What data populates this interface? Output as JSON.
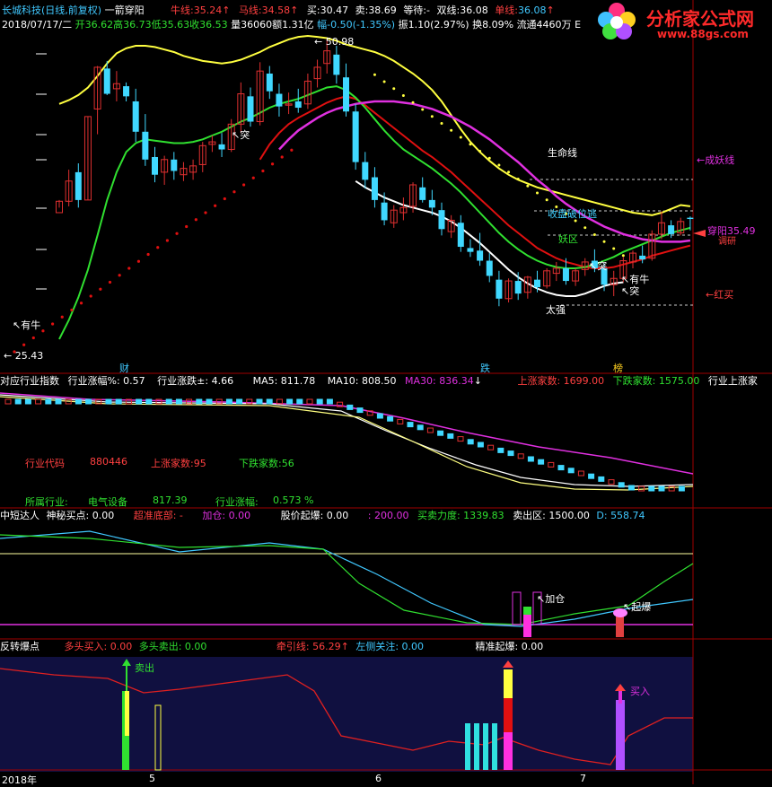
{
  "header": {
    "stock": "长城科技",
    "mode": "(日线,前复权)",
    "formula": "一箭穿阳",
    "niu_label": "牛线:",
    "niu_val": "35.24",
    "ma_label": "马线:",
    "ma_val": "34.58",
    "buy_label": "买:",
    "buy_val": "30.47",
    "sell_label": "卖:",
    "sell_val": "38.69",
    "wait_label": "等待:",
    "wait_val": "-",
    "double_label": "双线:",
    "double_val": "36.08",
    "single_label": "单线:",
    "single_val": "36.08",
    "date": "2018/07/17/二",
    "open": "开36.62",
    "high": "高36.73",
    "low": "低35.63",
    "close": "收36.53",
    "vol": "量36060",
    "amt": "额1.31亿",
    "fu": "幅-0.50(-1.35%)",
    "zhen": "振1.10(2.97%)",
    "huan": "换8.09%",
    "liutong": "流通4460万",
    "e_trunc": "E"
  },
  "logo": {
    "text": "分析家公式网",
    "url": "www.88gs.com"
  },
  "main_panel": {
    "top_value": "50.98",
    "bottom_value": "25.43",
    "annotations": {
      "chengyao": "←成妖线",
      "shengming": "生命线",
      "shoupan": "收盘破位逃",
      "chuanyang": "穿阳",
      "chuanyang_val": "35.49",
      "hongmai": "←红买",
      "youniu_left": "有牛",
      "youniu_right": "有牛",
      "tu1": "突",
      "tu2": "突",
      "tu3": "突",
      "taiqiang": "太强",
      "yaoqu": "妖区",
      "tiaozhu": "调研"
    },
    "markers": {
      "cai": "财",
      "die": "跌",
      "bang": "榜"
    }
  },
  "industry_panel": {
    "title": "对应行业指数",
    "zhangfu": "行业涨幅%: 0.57",
    "zhangdie": "行业涨跌±: 4.66",
    "ma5": "MA5: 811.78",
    "ma10": "MA10: 808.50",
    "ma30": "MA30: 836.34",
    "up_count": "上涨家数: 1699.00",
    "down_count": "下跌家数: 1575.00",
    "up_trunc": "行业上涨家",
    "code_label": "行业代码",
    "code_val": "880446",
    "up2_label": "上涨家数:95",
    "down2_label": "下跌家数:56",
    "belong_label": "所属行业:",
    "belong_val": "电气设备",
    "belong_num": "817.39",
    "zf_label": "行业涨幅:",
    "zf_val": "0.573 %"
  },
  "mid_panel": {
    "title": "中短达人",
    "shenmi": "神秘买点: 0.00",
    "chaozhun": "超准底部: -",
    "jiacang": "加仓: 0.00",
    "gujia": "股价起爆: 0.00",
    "v200": ": 200.00",
    "maimai": "买卖力度: 1339.83",
    "maichu": "卖出区: 1500.00",
    "d": "D: 558.74",
    "jiacang_ann": "加仓",
    "qibao_ann": "起爆"
  },
  "bottom_panel": {
    "title": "反转爆点",
    "duotou_buy": "多头买入: 0.00",
    "duotou_sell": "多头卖出: 0.00",
    "qianyin": "牵引线: 56.29",
    "zuoce": "左侧关注: 0.00",
    "jingzhun": "精准起爆: 0.00",
    "maichu_ann": "卖出",
    "mairu_ann": "买入"
  },
  "x_axis": {
    "year": "2018年",
    "ticks": [
      "5",
      "6",
      "7"
    ]
  },
  "chart_data": {
    "type": "line",
    "title": "",
    "y_range": [
      25.43,
      50.98
    ],
    "candles": [
      [
        37.0,
        38.0,
        37.4,
        37.9
      ],
      [
        37.9,
        40.4,
        37.5,
        39.5
      ],
      [
        40.2,
        40.9,
        37.4,
        38.0
      ],
      [
        38.0,
        44.6,
        38.0,
        44.6
      ],
      [
        45.2,
        48.6,
        43.2,
        48.5
      ],
      [
        48.4,
        49.0,
        46.3,
        46.4
      ],
      [
        46.8,
        48.2,
        45.8,
        47.2
      ],
      [
        47.0,
        47.3,
        45.8,
        46.2
      ],
      [
        45.8,
        46.8,
        42.6,
        43.4
      ],
      [
        43.4,
        44.8,
        40.7,
        41.2
      ],
      [
        41.4,
        42.2,
        39.4,
        40.0
      ],
      [
        40.2,
        41.5,
        39.2,
        41.2
      ],
      [
        41.2,
        41.8,
        39.6,
        40.3
      ],
      [
        40.0,
        41.0,
        39.5,
        40.5
      ],
      [
        40.2,
        41.2,
        39.6,
        40.7
      ],
      [
        40.8,
        42.6,
        40.2,
        42.3
      ],
      [
        42.4,
        43.1,
        41.8,
        42.6
      ],
      [
        42.4,
        43.3,
        41.4,
        42.0
      ],
      [
        42.0,
        44.4,
        41.8,
        44.0
      ],
      [
        44.0,
        47.3,
        43.3,
        46.4
      ],
      [
        46.2,
        46.9,
        43.8,
        44.2
      ],
      [
        44.2,
        48.9,
        43.9,
        48.2
      ],
      [
        48.0,
        48.6,
        46.0,
        46.6
      ],
      [
        46.4,
        47.2,
        44.6,
        45.4
      ],
      [
        45.5,
        46.5,
        44.8,
        45.6
      ],
      [
        45.8,
        46.8,
        44.9,
        45.3
      ],
      [
        45.6,
        48.0,
        45.2,
        47.4
      ],
      [
        47.6,
        49.1,
        46.9,
        48.5
      ],
      [
        48.8,
        50.7,
        48.0,
        49.8
      ],
      [
        49.5,
        50.2,
        47.2,
        47.9
      ],
      [
        47.7,
        48.8,
        44.6,
        45.0
      ],
      [
        45.0,
        45.6,
        40.4,
        41.0
      ],
      [
        41.0,
        41.8,
        38.9,
        39.6
      ],
      [
        39.8,
        40.6,
        37.4,
        38.0
      ],
      [
        37.8,
        38.6,
        36.0,
        36.4
      ],
      [
        36.2,
        37.6,
        35.8,
        37.2
      ],
      [
        37.0,
        38.2,
        36.4,
        37.4
      ],
      [
        37.5,
        39.4,
        37.0,
        39.2
      ],
      [
        39.0,
        39.8,
        37.8,
        38.0
      ],
      [
        38.0,
        38.8,
        36.8,
        37.4
      ],
      [
        37.2,
        37.8,
        35.2,
        35.7
      ],
      [
        35.5,
        36.8,
        35.0,
        36.4
      ],
      [
        36.2,
        36.8,
        33.9,
        34.3
      ],
      [
        34.2,
        34.9,
        33.5,
        33.9
      ],
      [
        34.0,
        35.4,
        32.8,
        33.2
      ],
      [
        33.2,
        33.8,
        31.5,
        32.0
      ],
      [
        31.7,
        32.4,
        29.6,
        30.2
      ],
      [
        30.2,
        31.8,
        29.9,
        31.6
      ],
      [
        31.6,
        32.3,
        30.1,
        30.6
      ],
      [
        30.7,
        32.0,
        30.2,
        31.9
      ],
      [
        31.7,
        32.4,
        30.7,
        31.1
      ],
      [
        31.2,
        32.6,
        31.0,
        32.4
      ],
      [
        32.2,
        33.1,
        31.6,
        32.6
      ],
      [
        32.6,
        33.4,
        31.3,
        31.6
      ],
      [
        31.6,
        32.6,
        31.2,
        32.4
      ],
      [
        32.5,
        33.4,
        32.0,
        33.1
      ],
      [
        33.2,
        34.1,
        32.3,
        32.6
      ],
      [
        32.6,
        33.0,
        30.8,
        31.3
      ],
      [
        31.3,
        32.4,
        30.4,
        31.8
      ],
      [
        31.8,
        33.5,
        31.5,
        33.2
      ],
      [
        33.1,
        34.0,
        32.6,
        33.8
      ],
      [
        33.6,
        34.4,
        33.0,
        33.3
      ],
      [
        33.4,
        35.6,
        33.2,
        35.3
      ],
      [
        35.3,
        37.1,
        34.9,
        36.2
      ],
      [
        36.0,
        36.4,
        35.0,
        35.3
      ],
      [
        35.4,
        36.6,
        35.2,
        36.3
      ],
      [
        36.6,
        36.7,
        35.6,
        36.5
      ]
    ],
    "series": [
      {
        "name": "牛线",
        "color": "#ffff40",
        "values": [
          45.6,
          45.9,
          46.3,
          46.9,
          47.8,
          48.8,
          49.6,
          50.0,
          50.2,
          50.2,
          50.1,
          49.9,
          49.7,
          49.4,
          49.2,
          49.0,
          48.9,
          48.8,
          48.9,
          49.1,
          49.4,
          49.7,
          50.1,
          50.4,
          50.7,
          50.9,
          50.98,
          50.9,
          50.8,
          50.6,
          50.3,
          50.1,
          49.9,
          49.7,
          49.4,
          49.0,
          48.5,
          48.0,
          47.4,
          46.7,
          45.8,
          44.7,
          43.6,
          42.6,
          41.8,
          41.1,
          40.5,
          40.0,
          39.6,
          39.3,
          39.0,
          38.8,
          38.6,
          38.4,
          38.2,
          38.0,
          37.8,
          37.6,
          37.4,
          37.2,
          37.0,
          36.9,
          36.8,
          37.0,
          37.3,
          37.6,
          37.5
        ]
      },
      {
        "name": "马线",
        "color": "#ffffff",
        "values": [
          null,
          null,
          null,
          null,
          null,
          null,
          null,
          null,
          null,
          null,
          null,
          null,
          null,
          null,
          null,
          null,
          null,
          null,
          null,
          null,
          null,
          null,
          null,
          null,
          null,
          null,
          null,
          null,
          null,
          null,
          null,
          39.5,
          39.0,
          38.6,
          38.2,
          37.9,
          37.6,
          37.4,
          37.2,
          37.0,
          36.7,
          36.3,
          35.8,
          35.2,
          34.6,
          33.9,
          33.2,
          32.5,
          31.9,
          31.4,
          31.0,
          30.7,
          30.5,
          30.4,
          30.4,
          30.6,
          30.9,
          31.2,
          31.4,
          31.5,
          null,
          null,
          null,
          null,
          null,
          null,
          null
        ]
      },
      {
        "name": "红线",
        "color": "#e01010",
        "values": [
          null,
          null,
          null,
          null,
          null,
          null,
          null,
          null,
          null,
          null,
          null,
          null,
          null,
          null,
          null,
          null,
          null,
          null,
          null,
          null,
          null,
          41.2,
          42.4,
          43.3,
          44.0,
          44.5,
          44.9,
          45.3,
          45.7,
          46.0,
          46.2,
          46.0,
          45.5,
          44.9,
          44.3,
          43.7,
          43.1,
          42.5,
          41.9,
          41.4,
          40.8,
          40.2,
          39.5,
          38.8,
          38.1,
          37.4,
          36.7,
          36.0,
          35.4,
          34.8,
          34.2,
          33.8,
          33.4,
          33.1,
          32.9,
          32.7,
          32.6,
          32.6,
          32.7,
          32.9,
          33.1,
          33.3,
          33.6,
          33.8,
          34.0,
          34.2,
          34.4
        ]
      },
      {
        "name": "绿线",
        "color": "#30e030",
        "values": [
          27.0,
          28.5,
          30.3,
          32.5,
          35.2,
          38.0,
          40.2,
          41.8,
          42.5,
          42.8,
          42.7,
          42.6,
          42.5,
          42.5,
          42.6,
          42.8,
          43.1,
          43.4,
          43.8,
          44.2,
          44.5,
          44.9,
          45.3,
          45.6,
          45.8,
          46.0,
          46.3,
          46.6,
          46.9,
          47.0,
          46.7,
          46.1,
          45.3,
          44.4,
          43.5,
          42.7,
          42.0,
          41.5,
          41.0,
          40.5,
          39.9,
          39.3,
          38.6,
          37.8,
          37.0,
          36.2,
          35.4,
          34.7,
          34.1,
          33.6,
          33.2,
          32.9,
          32.7,
          32.6,
          32.6,
          32.7,
          32.9,
          33.2,
          33.5,
          33.9,
          34.2,
          34.5,
          34.8,
          35.1,
          35.4,
          35.6,
          35.8
        ]
      },
      {
        "name": "成妖线",
        "color": "#e030e0",
        "values": [
          null,
          null,
          null,
          null,
          null,
          null,
          null,
          null,
          null,
          null,
          null,
          null,
          null,
          null,
          null,
          null,
          null,
          null,
          null,
          null,
          null,
          null,
          null,
          42.0,
          42.8,
          43.5,
          44.0,
          44.5,
          44.9,
          45.2,
          45.4,
          45.6,
          45.7,
          45.8,
          45.8,
          45.8,
          45.7,
          45.6,
          45.4,
          45.2,
          44.9,
          44.6,
          44.2,
          43.8,
          43.3,
          42.8,
          42.2,
          41.6,
          41.0,
          40.3,
          39.6,
          39.0,
          38.3,
          37.7,
          37.2,
          36.7,
          36.3,
          35.9,
          35.6,
          35.3,
          35.1,
          34.9,
          34.8,
          34.7,
          34.7,
          34.7,
          34.8
        ]
      }
    ]
  }
}
